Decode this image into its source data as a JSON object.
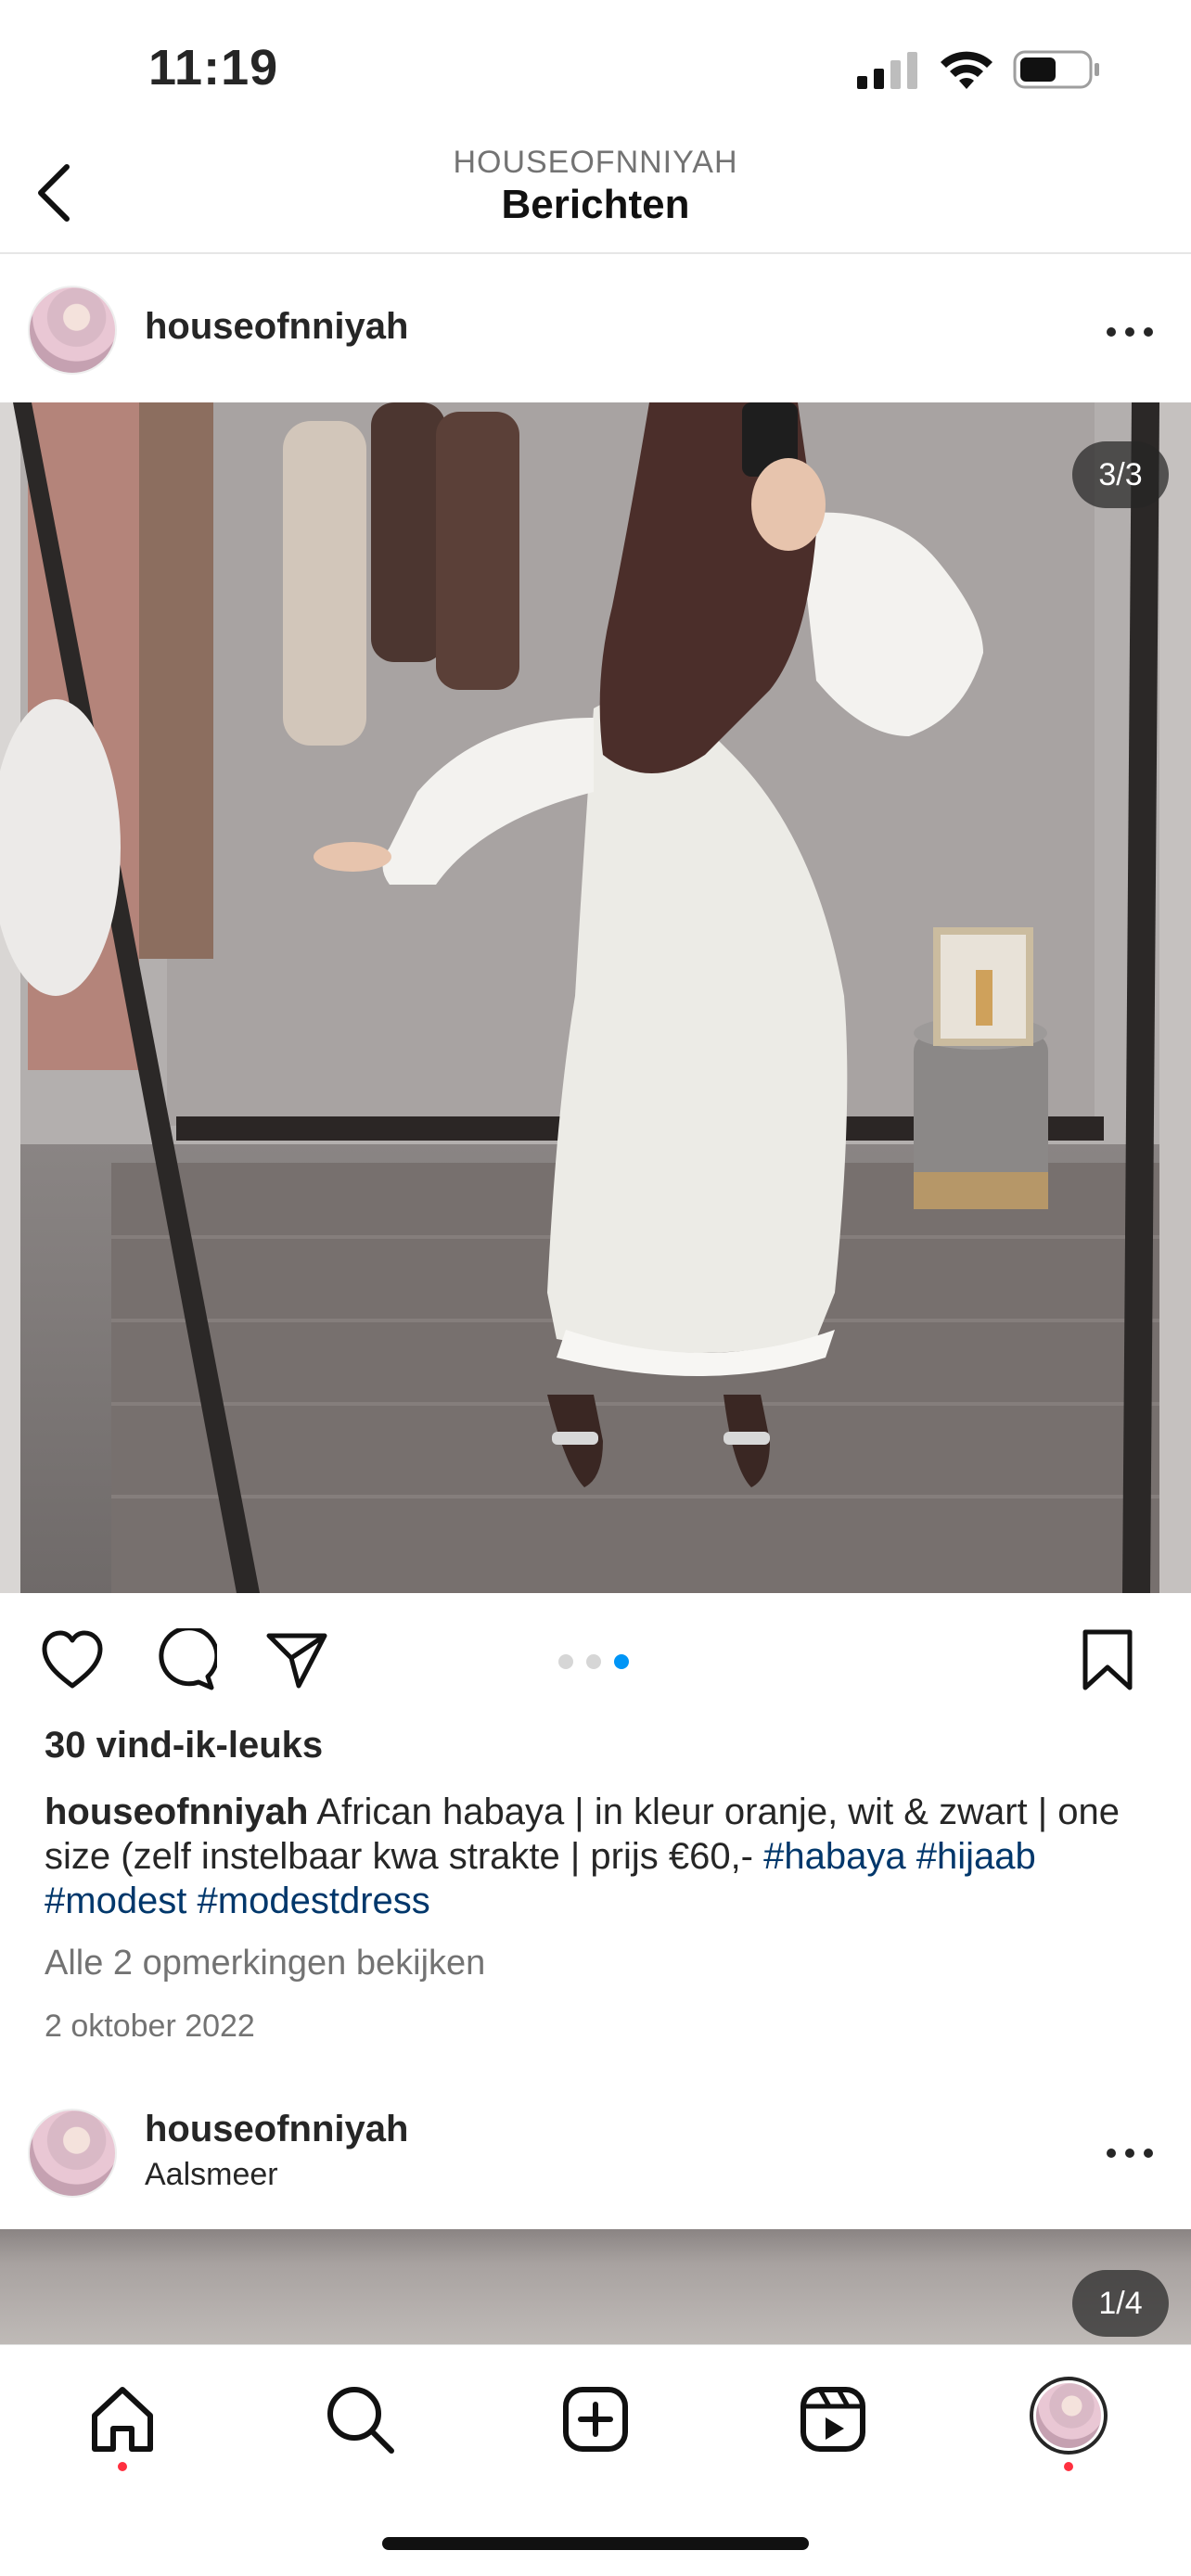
{
  "status_bar": {
    "time": "11:19",
    "signal_icon": "signal-icon",
    "wifi_icon": "wifi-icon",
    "battery_icon": "battery-icon"
  },
  "header": {
    "subtitle": "HOUSEOFNNIYAH",
    "title": "Berichten",
    "back_icon": "chevron-left-icon"
  },
  "post": {
    "username": "houseofnniyah",
    "image_counter": "3/3",
    "likes": "30 vind-ik-leuks",
    "caption_user": "houseofnniyah",
    "caption_text": " African habaya | in kleur oranje, wit & zwart | one size (zelf instelbaar kwa strakte | prijs €60,- ",
    "hashtags": [
      "#habaya",
      "#hijaab",
      "#modest",
      "#modestdress"
    ],
    "comments_link": "Alle 2 opmerkingen bekijken",
    "date": "2 oktober 2022",
    "carousel": {
      "count": 3,
      "active": 3
    }
  },
  "next_post": {
    "username": "houseofnniyah",
    "location": "Aalsmeer",
    "image_counter": "1/4"
  },
  "colors": {
    "accent_blue": "#0095f6",
    "hashtag": "#00376b",
    "notification": "#ff3040",
    "muted": "#737373"
  },
  "tabbar": {
    "items": [
      "home-icon",
      "search-icon",
      "create-icon",
      "reels-icon",
      "profile-avatar"
    ]
  }
}
